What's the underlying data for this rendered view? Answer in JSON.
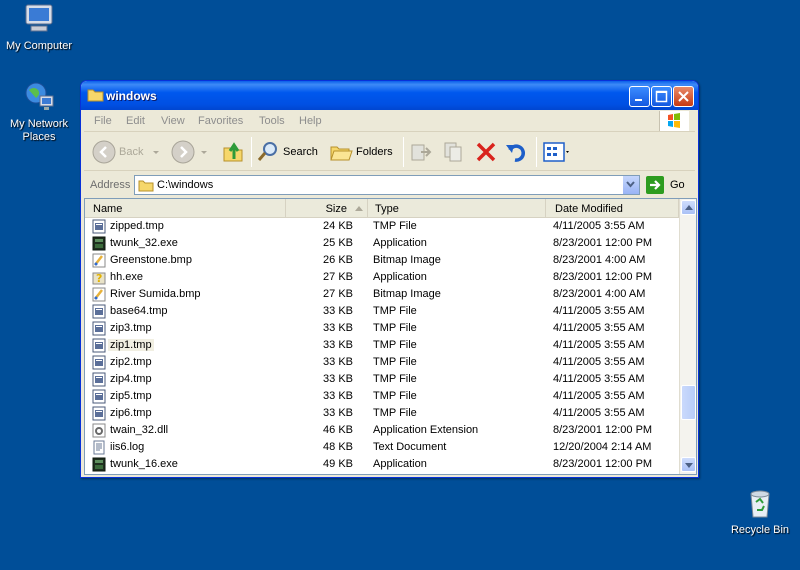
{
  "desktop": {
    "icons": [
      {
        "label": "My Computer",
        "icon": "my-computer-icon"
      },
      {
        "label": "My Network Places",
        "icon": "network-places-icon"
      },
      {
        "label": "Recycle Bin",
        "icon": "recycle-bin-icon"
      }
    ],
    "background_color": "#004e98"
  },
  "window": {
    "title": "windows",
    "menu": [
      "File",
      "Edit",
      "View",
      "Favorites",
      "Tools",
      "Help"
    ],
    "toolbar": {
      "back_label": "Back",
      "search_label": "Search",
      "folders_label": "Folders"
    },
    "address": {
      "label": "Address",
      "value": "C:\\windows",
      "go_label": "Go"
    },
    "columns": {
      "name": "Name",
      "size": "Size",
      "type": "Type",
      "date": "Date Modified"
    },
    "files": [
      {
        "name": "zipped.tmp",
        "size": "24 KB",
        "type": "TMP File",
        "date": "4/11/2005 3:55 AM",
        "icon": "tmp-file-icon"
      },
      {
        "name": "twunk_32.exe",
        "size": "25 KB",
        "type": "Application",
        "date": "8/23/2001 12:00 PM",
        "icon": "application-icon"
      },
      {
        "name": "Greenstone.bmp",
        "size": "26 KB",
        "type": "Bitmap Image",
        "date": "8/23/2001 4:00 AM",
        "icon": "bitmap-icon"
      },
      {
        "name": "hh.exe",
        "size": "27 KB",
        "type": "Application",
        "date": "8/23/2001 12:00 PM",
        "icon": "help-exe-icon"
      },
      {
        "name": "River Sumida.bmp",
        "size": "27 KB",
        "type": "Bitmap Image",
        "date": "8/23/2001 4:00 AM",
        "icon": "bitmap-icon"
      },
      {
        "name": "base64.tmp",
        "size": "33 KB",
        "type": "TMP File",
        "date": "4/11/2005 3:55 AM",
        "icon": "tmp-file-icon"
      },
      {
        "name": "zip3.tmp",
        "size": "33 KB",
        "type": "TMP File",
        "date": "4/11/2005 3:55 AM",
        "icon": "tmp-file-icon"
      },
      {
        "name": "zip1.tmp",
        "size": "33 KB",
        "type": "TMP File",
        "date": "4/11/2005 3:55 AM",
        "icon": "tmp-file-icon"
      },
      {
        "name": "zip2.tmp",
        "size": "33 KB",
        "type": "TMP File",
        "date": "4/11/2005 3:55 AM",
        "icon": "tmp-file-icon"
      },
      {
        "name": "zip4.tmp",
        "size": "33 KB",
        "type": "TMP File",
        "date": "4/11/2005 3:55 AM",
        "icon": "tmp-file-icon"
      },
      {
        "name": "zip5.tmp",
        "size": "33 KB",
        "type": "TMP File",
        "date": "4/11/2005 3:55 AM",
        "icon": "tmp-file-icon"
      },
      {
        "name": "zip6.tmp",
        "size": "33 KB",
        "type": "TMP File",
        "date": "4/11/2005 3:55 AM",
        "icon": "tmp-file-icon"
      },
      {
        "name": "twain_32.dll",
        "size": "46 KB",
        "type": "Application Extension",
        "date": "8/23/2001 12:00 PM",
        "icon": "dll-icon"
      },
      {
        "name": "iis6.log",
        "size": "48 KB",
        "type": "Text Document",
        "date": "12/20/2004 2:14 AM",
        "icon": "text-document-icon"
      },
      {
        "name": "twunk_16.exe",
        "size": "49 KB",
        "type": "Application",
        "date": "8/23/2001 12:00 PM",
        "icon": "application-icon"
      }
    ],
    "highlighted_file": "zip1.tmp"
  }
}
